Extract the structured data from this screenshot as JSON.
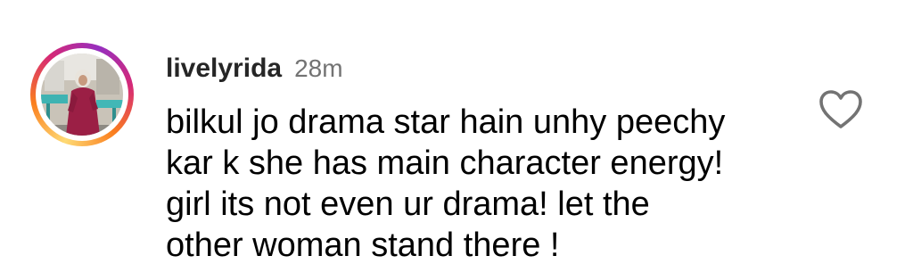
{
  "comment": {
    "username": "livelyrida",
    "time": "28m",
    "text_lines": [
      "bilkul jo drama star hain unhy peechy",
      "kar k she has main character energy!",
      "girl its not even ur drama! let the",
      "other woman stand there !"
    ],
    "avatar_icon": "profile-photo",
    "like_icon": "heart-outline-icon",
    "colors": {
      "username": "#262626",
      "time": "#737373",
      "text": "#000000",
      "ring_gradient": [
        "#feda75",
        "#fa7e1e",
        "#d62976",
        "#962fbf"
      ]
    }
  }
}
